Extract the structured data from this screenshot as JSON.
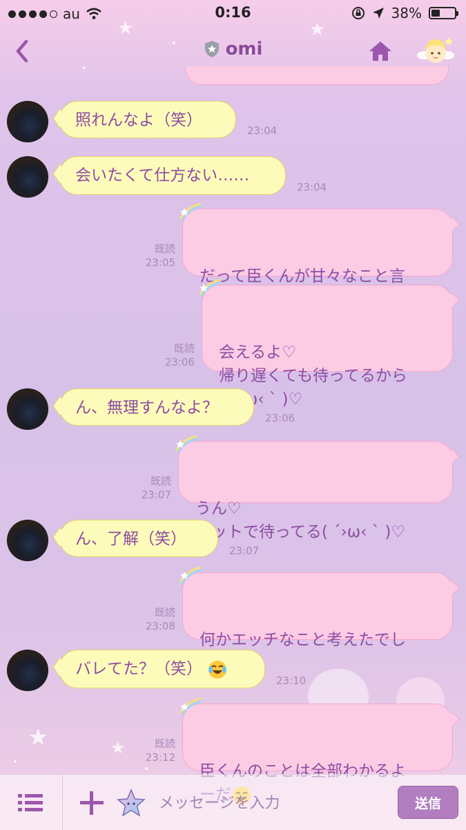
{
  "status_bar": {
    "carrier": "au",
    "time": "0:16",
    "battery": "38%",
    "battery_level": 0.38,
    "signal_bars": 4
  },
  "header": {
    "title": "omi",
    "back_icon": "chevron-left-icon",
    "verified_icon": "shield-star-icon",
    "home_icon": "home-icon",
    "theme_icon": "cupid-character-icon"
  },
  "messages": [
    {
      "side": "in",
      "text": "照れんなよ（笑）",
      "time": "23:04"
    },
    {
      "side": "in",
      "text": "会いたくて仕方ない……",
      "time": "23:04"
    },
    {
      "side": "out",
      "text": "だって臣くんが甘々なこと言\nうから♡♡",
      "read": "既読",
      "time": "23:05"
    },
    {
      "side": "out",
      "text": "会えるよ♡\n帰り遅くても待ってるから\n( ´›ω‹ ` )♡",
      "read": "既読",
      "time": "23:06"
    },
    {
      "side": "in",
      "text": "ん、無理すんなよ？",
      "time": "23:06"
    },
    {
      "side": "out",
      "text": "うん♡\nベットで待ってる( ´›ω‹ ` )♡",
      "read": "既読",
      "time": "23:07"
    },
    {
      "side": "in",
      "text": "ん、了解（笑）",
      "time": "23:07"
    },
    {
      "side": "out",
      "text": "何かエッチなこと考えたでし\nょ？笑",
      "read": "既読",
      "time": "23:08"
    },
    {
      "side": "in",
      "text": "バレてた？（笑）",
      "emoji": "face-with-tears-of-joy",
      "time": "23:10"
    },
    {
      "side": "out",
      "text": "臣くんのことは全部わかるよ\nーだ",
      "emoji": "smirking-face",
      "read": "既読",
      "time": "23:12"
    }
  ],
  "input_bar": {
    "menu_icon": "list-menu-icon",
    "plus_icon": "plus-icon",
    "sticker_icon": "star-sticker-icon",
    "placeholder": "メッセージを入力",
    "send_label": "送信"
  },
  "colors": {
    "accent": "#8d4da3",
    "incoming_bubble": "#fdfbba",
    "outgoing_bubble": "#fccbe4",
    "send_button": "#b27ec0"
  }
}
